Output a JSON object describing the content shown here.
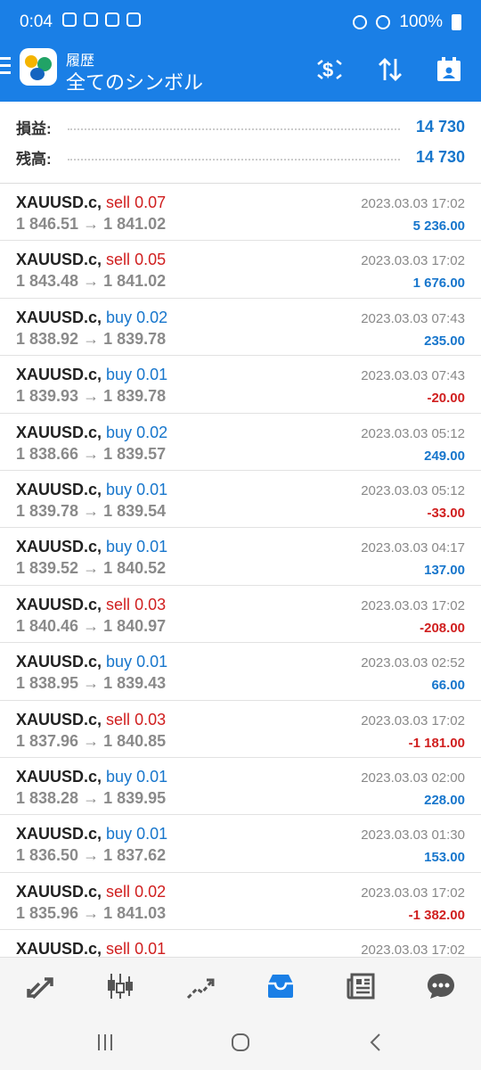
{
  "status": {
    "time": "0:04",
    "battery": "100%"
  },
  "toolbar": {
    "title_small": "履歴",
    "title_big": "全てのシンボル"
  },
  "summary": {
    "profit_label": "損益:",
    "profit_value": "14 730",
    "balance_label": "残高:",
    "balance_value": "14 730"
  },
  "trades": [
    {
      "symbol": "XAUUSD.c,",
      "side": "sell",
      "volume": "0.07",
      "open": "1 846.51",
      "close": "1 841.02",
      "time": "2023.03.03 17:02",
      "profit": "5 236.00",
      "profit_sign": "pos"
    },
    {
      "symbol": "XAUUSD.c,",
      "side": "sell",
      "volume": "0.05",
      "open": "1 843.48",
      "close": "1 841.02",
      "time": "2023.03.03 17:02",
      "profit": "1 676.00",
      "profit_sign": "pos"
    },
    {
      "symbol": "XAUUSD.c,",
      "side": "buy",
      "volume": "0.02",
      "open": "1 838.92",
      "close": "1 839.78",
      "time": "2023.03.03 07:43",
      "profit": "235.00",
      "profit_sign": "pos"
    },
    {
      "symbol": "XAUUSD.c,",
      "side": "buy",
      "volume": "0.01",
      "open": "1 839.93",
      "close": "1 839.78",
      "time": "2023.03.03 07:43",
      "profit": "-20.00",
      "profit_sign": "neg"
    },
    {
      "symbol": "XAUUSD.c,",
      "side": "buy",
      "volume": "0.02",
      "open": "1 838.66",
      "close": "1 839.57",
      "time": "2023.03.03 05:12",
      "profit": "249.00",
      "profit_sign": "pos"
    },
    {
      "symbol": "XAUUSD.c,",
      "side": "buy",
      "volume": "0.01",
      "open": "1 839.78",
      "close": "1 839.54",
      "time": "2023.03.03 05:12",
      "profit": "-33.00",
      "profit_sign": "neg"
    },
    {
      "symbol": "XAUUSD.c,",
      "side": "buy",
      "volume": "0.01",
      "open": "1 839.52",
      "close": "1 840.52",
      "time": "2023.03.03 04:17",
      "profit": "137.00",
      "profit_sign": "pos"
    },
    {
      "symbol": "XAUUSD.c,",
      "side": "sell",
      "volume": "0.03",
      "open": "1 840.46",
      "close": "1 840.97",
      "time": "2023.03.03 17:02",
      "profit": "-208.00",
      "profit_sign": "neg"
    },
    {
      "symbol": "XAUUSD.c,",
      "side": "buy",
      "volume": "0.01",
      "open": "1 838.95",
      "close": "1 839.43",
      "time": "2023.03.03 02:52",
      "profit": "66.00",
      "profit_sign": "pos"
    },
    {
      "symbol": "XAUUSD.c,",
      "side": "sell",
      "volume": "0.03",
      "open": "1 837.96",
      "close": "1 840.85",
      "time": "2023.03.03 17:02",
      "profit": "-1 181.00",
      "profit_sign": "neg"
    },
    {
      "symbol": "XAUUSD.c,",
      "side": "buy",
      "volume": "0.01",
      "open": "1 838.28",
      "close": "1 839.95",
      "time": "2023.03.03 02:00",
      "profit": "228.00",
      "profit_sign": "pos"
    },
    {
      "symbol": "XAUUSD.c,",
      "side": "buy",
      "volume": "0.01",
      "open": "1 836.50",
      "close": "1 837.62",
      "time": "2023.03.03 01:30",
      "profit": "153.00",
      "profit_sign": "pos"
    },
    {
      "symbol": "XAUUSD.c,",
      "side": "sell",
      "volume": "0.02",
      "open": "1 835.96",
      "close": "1 841.03",
      "time": "2023.03.03 17:02",
      "profit": "-1 382.00",
      "profit_sign": "neg"
    },
    {
      "symbol": "XAUUSD.c,",
      "side": "sell",
      "volume": "0.01",
      "open": "",
      "close": "",
      "time": "2023.03.03 17:02",
      "profit": "",
      "profit_sign": "pos"
    }
  ],
  "colors": {
    "accent": "#1a7fe6",
    "buy": "#1776cc",
    "sell": "#d01f1f"
  },
  "bottom_nav": [
    "quotes-icon",
    "chart-icon",
    "trade-icon",
    "history-icon",
    "news-icon",
    "chat-icon"
  ]
}
